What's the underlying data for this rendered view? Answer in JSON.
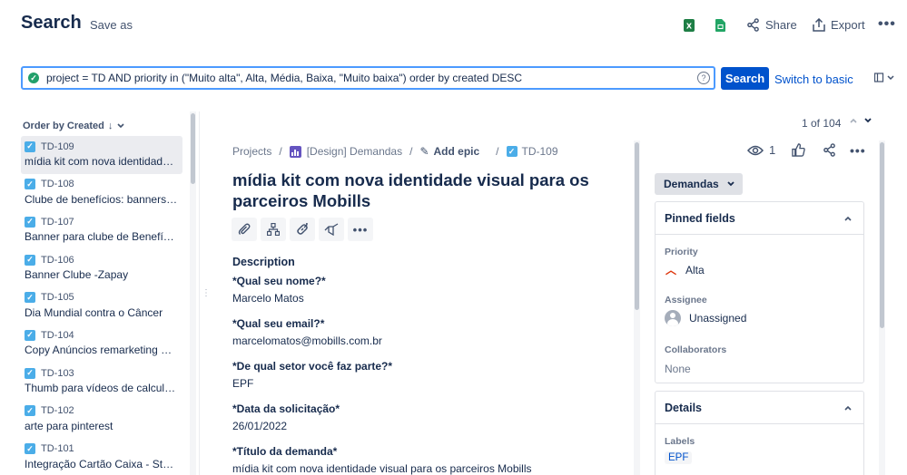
{
  "header": {
    "title": "Search",
    "save_as": "Save as",
    "share": "Share",
    "export": "Export",
    "excel_icon": "excel-icon",
    "sheets_icon": "google-sheets-icon"
  },
  "jql": {
    "query": "project = TD AND priority in (\"Muito alta\", Alta, Média, Baixa, \"Muito baixa\") order by created DESC",
    "search_label": "Search",
    "switch_label": "Switch to basic"
  },
  "list": {
    "order_by": "Order by Created",
    "items": [
      {
        "key": "TD-109",
        "summary": "mídia kit com nova identidade visual para os parceiros Mobills"
      },
      {
        "key": "TD-108",
        "summary": "Clube de benefícios: banners para parceiros"
      },
      {
        "key": "TD-107",
        "summary": "Banner para clube de Benefícios"
      },
      {
        "key": "TD-106",
        "summary": "Banner Clube -Zapay"
      },
      {
        "key": "TD-105",
        "summary": "Dia Mundial contra o Câncer"
      },
      {
        "key": "TD-104",
        "summary": "Copy Anúncios remarketing Cri..."
      },
      {
        "key": "TD-103",
        "summary": "Thumb para vídeos de calculad..."
      },
      {
        "key": "TD-102",
        "summary": "arte para pinterest"
      },
      {
        "key": "TD-101",
        "summary": "Integração Cartão Caixa - Stor..."
      }
    ]
  },
  "pager": {
    "text": "1 of 104"
  },
  "breadcrumbs": {
    "projects": "Projects",
    "project": "[Design] Demandas",
    "epic": "Add epic",
    "issue": "TD-109"
  },
  "issue": {
    "title": "mídia kit com nova identidade visual para os parceiros Mobills",
    "description_label": "Description",
    "fields": [
      {
        "q": "*Qual seu nome?*",
        "a": "Marcelo Matos"
      },
      {
        "q": "*Qual seu email?*",
        "a": "marcelomatos@mobills.com.br"
      },
      {
        "q": "*De qual setor você faz parte?*",
        "a": "EPF"
      },
      {
        "q": "*Data da solicitação*",
        "a": "26/01/2022"
      },
      {
        "q": "*Título da demanda*",
        "a": "mídia kit com nova identidade visual para os parceiros Mobills"
      }
    ]
  },
  "watchers": "1",
  "status": "Demandas",
  "pinned": {
    "title": "Pinned fields",
    "priority_label": "Priority",
    "priority_value": "Alta",
    "assignee_label": "Assignee",
    "assignee_value": "Unassigned",
    "collaborators_label": "Collaborators",
    "collaborators_value": "None"
  },
  "details": {
    "title": "Details",
    "labels_label": "Labels",
    "labels_value": "EPF"
  }
}
